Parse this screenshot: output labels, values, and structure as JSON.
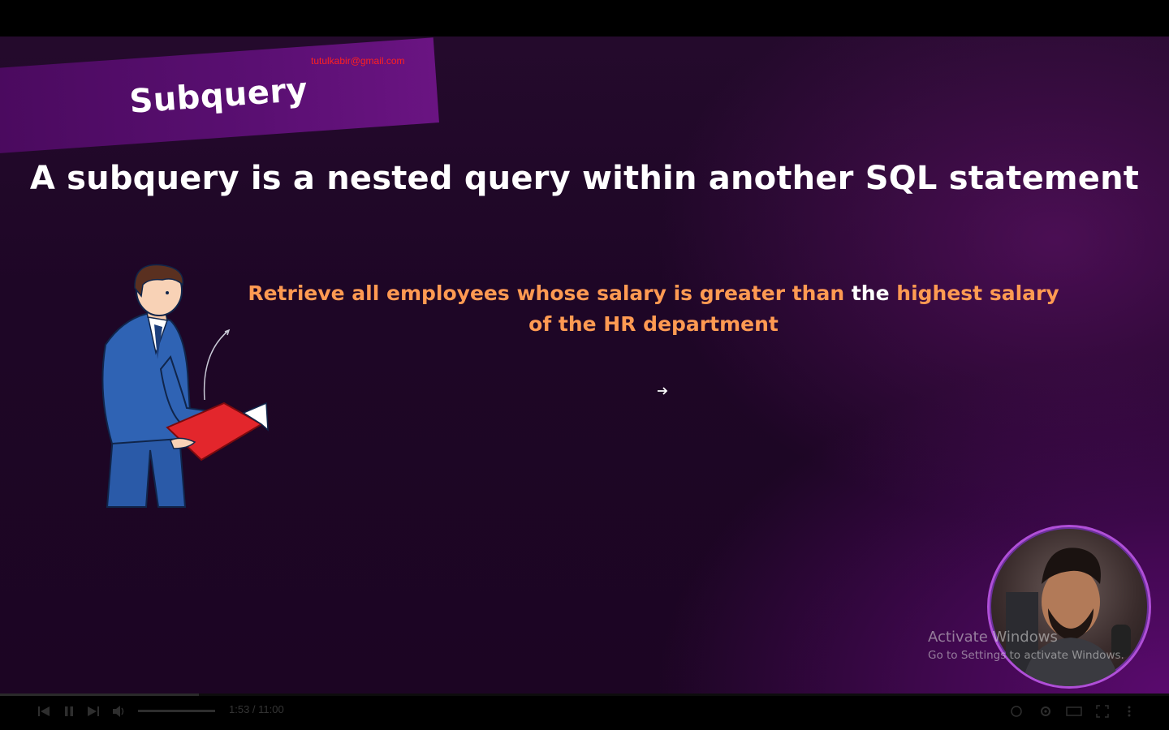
{
  "slide": {
    "title": "Subquery",
    "email_watermark": "tutulkabir@gmail.com",
    "definition": "A subquery is a nested query within another SQL statement",
    "question_part1": "Retrieve all employees whose salary is greater than ",
    "question_highlight": "the",
    "question_part2": " highest salary of the HR department"
  },
  "overlay": {
    "activate_title": "Activate Windows",
    "activate_subtitle": "Go to Settings to activate Windows."
  },
  "player": {
    "time": "1:53 / 11:00",
    "progress": 0.17,
    "icons": [
      "previous-icon",
      "pause-icon",
      "next-icon",
      "volume-icon",
      "autoplay-icon",
      "settings-icon",
      "theater-icon",
      "fullscreen-icon",
      "more-icon"
    ]
  },
  "colors": {
    "accent": "#ff9a52",
    "band": "#5a0f72",
    "watermark": "#ff2020",
    "presenter_ring": "#b04fd8"
  }
}
